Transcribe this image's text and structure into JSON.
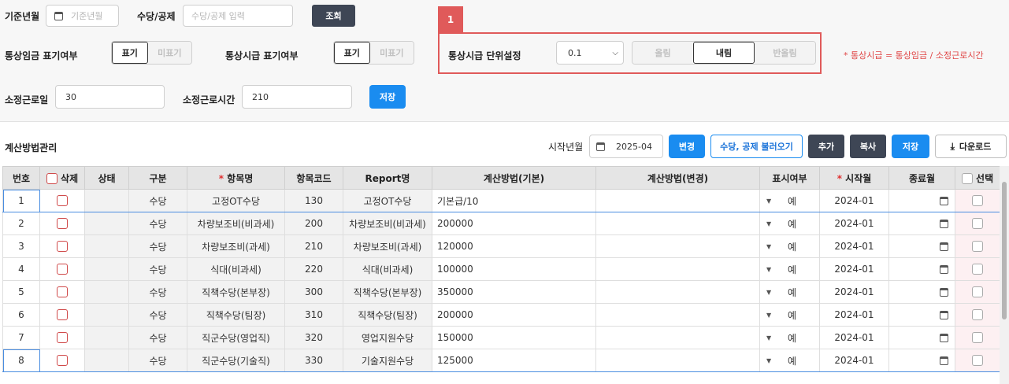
{
  "filters": {
    "base_ym_label": "기준년월",
    "base_ym_placeholder": "기준년월",
    "allowance_label": "수당/공제",
    "allowance_placeholder": "수당/공제 입력",
    "search_button": "조회"
  },
  "display": {
    "ordinary_wage_label": "통상임금 표기여부",
    "ordinary_hourly_label": "통상시급 표기여부",
    "show": "표기",
    "hide": "미표기"
  },
  "unit": {
    "tag": "1",
    "label": "통상시급 단위설정",
    "select_value": "0.1",
    "round_up": "올림",
    "round_down": "내림",
    "round": "반올림",
    "note": "* 통상시급 = 통상임금 / 소정근로시간"
  },
  "work": {
    "days_label": "소정근로일",
    "days_value": "30",
    "hours_label": "소정근로시간",
    "hours_value": "210",
    "save_button": "저장"
  },
  "toolbar": {
    "section_title": "계산방법관리",
    "start_ym_label": "시작년월",
    "start_ym_value": "2025-04",
    "change": "변경",
    "load": "수당, 공제 불러오기",
    "add": "추가",
    "copy": "복사",
    "save": "저장",
    "download": "다운로드"
  },
  "table": {
    "headers": [
      "번호",
      "삭제",
      "상태",
      "구분",
      "항목명",
      "항목코드",
      "Report명",
      "계산방법(기본)",
      "계산방법(변경)",
      "표시여부",
      "시작월",
      "종료월",
      "선택"
    ],
    "rows": [
      {
        "no": "1",
        "type": "수당",
        "name": "고정OT수당",
        "code": "130",
        "report": "고정OT수당",
        "method": "기본급/10",
        "display": "예",
        "start": "2024-01"
      },
      {
        "no": "2",
        "type": "수당",
        "name": "차량보조비(비과세)",
        "code": "200",
        "report": "차량보조비(비과세)",
        "method": "200000",
        "display": "예",
        "start": "2024-01"
      },
      {
        "no": "3",
        "type": "수당",
        "name": "차량보조비(과세)",
        "code": "210",
        "report": "차량보조비(과세)",
        "method": "120000",
        "display": "예",
        "start": "2024-01"
      },
      {
        "no": "4",
        "type": "수당",
        "name": "식대(비과세)",
        "code": "220",
        "report": "식대(비과세)",
        "method": "100000",
        "display": "예",
        "start": "2024-01"
      },
      {
        "no": "5",
        "type": "수당",
        "name": "직책수당(본부장)",
        "code": "300",
        "report": "직책수당(본부장)",
        "method": "350000",
        "display": "예",
        "start": "2024-01"
      },
      {
        "no": "6",
        "type": "수당",
        "name": "직책수당(팀장)",
        "code": "310",
        "report": "직책수당(팀장)",
        "method": "200000",
        "display": "예",
        "start": "2024-01"
      },
      {
        "no": "7",
        "type": "수당",
        "name": "직군수당(영업직)",
        "code": "320",
        "report": "영업지원수당",
        "method": "150000",
        "display": "예",
        "start": "2024-01"
      },
      {
        "no": "8",
        "type": "수당",
        "name": "직군수당(기술직)",
        "code": "330",
        "report": "기술지원수당",
        "method": "125000",
        "display": "예",
        "start": "2024-01"
      }
    ]
  }
}
